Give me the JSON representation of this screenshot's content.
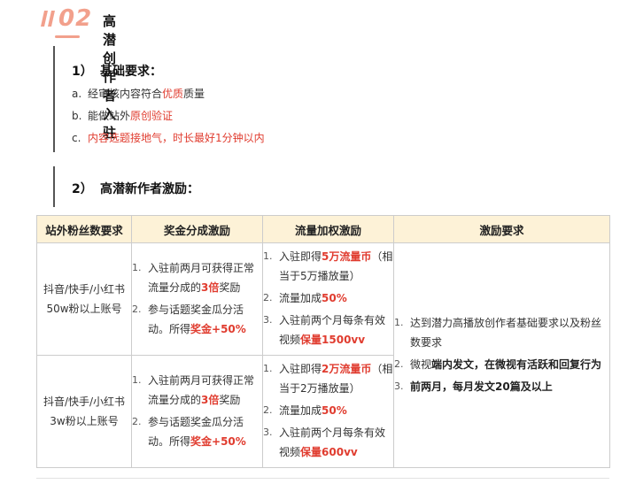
{
  "header": {
    "number": "02",
    "title": "高潜创作者入驻"
  },
  "section1": {
    "number": "1）",
    "title": "基础要求：",
    "items": [
      {
        "marker": "a.",
        "pre": "经审核内容符合",
        "hl": "优质",
        "post": "质量"
      },
      {
        "marker": "b.",
        "pre": "能做站外",
        "hl": "原创验证",
        "post": ""
      },
      {
        "marker": "c.",
        "text": "内容选题接地气，时长最好1分钟以内"
      }
    ]
  },
  "section2": {
    "number": "2）",
    "title": "高潜新作者激励："
  },
  "table": {
    "headers": [
      "站外粉丝数要求",
      "奖金分成激励",
      "流量加权激励",
      "激励要求"
    ],
    "rows": [
      {
        "tier": "抖音/快手/小红书 50w粉以上账号",
        "bonus": [
          {
            "n": "1.",
            "pre": "入驻前两月可获得正常流量分成的",
            "hl": "3倍",
            "post": "奖励"
          },
          {
            "n": "2.",
            "pre": "参与话题奖金瓜分活动。所得",
            "hl": "奖金+50%",
            "post": ""
          }
        ],
        "traffic": [
          {
            "n": "1.",
            "pre": "入驻即得",
            "hl": "5万流量币",
            "post": "（相当于5万播放量）"
          },
          {
            "n": "2.",
            "pre": "流量加成",
            "hl": "50%",
            "post": ""
          },
          {
            "n": "3.",
            "pre": "入驻前两个月每条有效视频",
            "hl": "保量1500vv",
            "post": ""
          }
        ]
      },
      {
        "tier": "抖音/快手/小红书 3w粉以上账号",
        "bonus": [
          {
            "n": "1.",
            "pre": "入驻前两月可获得正常流量分成的",
            "hl": "3倍",
            "post": "奖励"
          },
          {
            "n": "2.",
            "pre": "参与话题奖金瓜分活动。所得",
            "hl": "奖金+50%",
            "post": ""
          }
        ],
        "traffic": [
          {
            "n": "1.",
            "pre": "入驻即得",
            "hl": "2万流量币",
            "post": "（相当于2万播放量）"
          },
          {
            "n": "2.",
            "pre": "流量加成",
            "hl": "50%",
            "post": ""
          },
          {
            "n": "3.",
            "pre": "入驻前两个月每条有效视频",
            "hl": "保量600vv",
            "post": ""
          }
        ]
      }
    ],
    "requirements": [
      {
        "n": "1.",
        "pre": "达到潜力高播放创作者基础要求以及粉丝数要求",
        "bold": "",
        "post": ""
      },
      {
        "n": "2.",
        "pre": "微视",
        "bold": "端内发文",
        "post": "，在微视有活跃和回复行为"
      },
      {
        "n": "3.",
        "pre": "",
        "bold": "前两月，每月发文20篇及以上",
        "post": ""
      }
    ]
  },
  "colors": {
    "accent": "#f2a08c",
    "highlight": "#e03c2f",
    "header_bg": "#fdf2d7",
    "border": "#cccccc"
  }
}
